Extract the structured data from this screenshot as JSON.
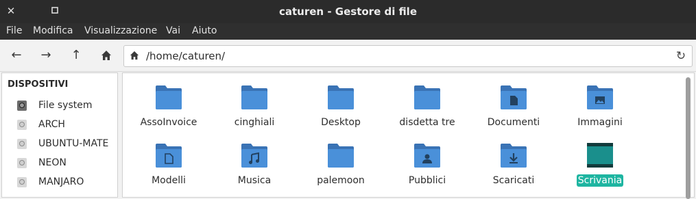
{
  "window": {
    "title": "caturen - Gestore di file",
    "close_glyph": "✕",
    "restore_glyph": "▫"
  },
  "menu": [
    "File",
    "Modifica",
    "Visualizzazione",
    "Vai",
    "Aiuto"
  ],
  "toolbar": {
    "back_glyph": "←",
    "forward_glyph": "→",
    "up_glyph": "↑",
    "reload_glyph": "↻",
    "location": "/home/caturen/"
  },
  "sidebar": {
    "heading": "DISPOSITIVI",
    "items": [
      {
        "label": "File system",
        "icon": "drive-icon",
        "active": true
      },
      {
        "label": "ARCH",
        "icon": "drive-icon"
      },
      {
        "label": "UBUNTU-MATE",
        "icon": "drive-icon"
      },
      {
        "label": "NEON",
        "icon": "drive-icon"
      },
      {
        "label": "MANJARO",
        "icon": "drive-icon"
      }
    ]
  },
  "files": [
    {
      "name": "AssoInvoice",
      "icon": "folder-icon"
    },
    {
      "name": "cinghiali",
      "icon": "folder-icon"
    },
    {
      "name": "Desktop",
      "icon": "folder-icon"
    },
    {
      "name": "disdetta tre",
      "icon": "folder-icon"
    },
    {
      "name": "Documenti",
      "icon": "folder-documents-icon"
    },
    {
      "name": "Immagini",
      "icon": "folder-pictures-icon"
    },
    {
      "name": "Modelli",
      "icon": "folder-templates-icon"
    },
    {
      "name": "Musica",
      "icon": "folder-music-icon"
    },
    {
      "name": "palemoon",
      "icon": "folder-icon"
    },
    {
      "name": "Pubblici",
      "icon": "folder-public-icon"
    },
    {
      "name": "Scaricati",
      "icon": "folder-download-icon"
    },
    {
      "name": "Scrivania",
      "icon": "desktop-folder-icon",
      "selected": true
    }
  ],
  "colors": {
    "folder": "#4a90d9",
    "folder_dark": "#3a73b5",
    "selection": "#1eb5a1",
    "desktop_icon": "#1a8f8c"
  }
}
